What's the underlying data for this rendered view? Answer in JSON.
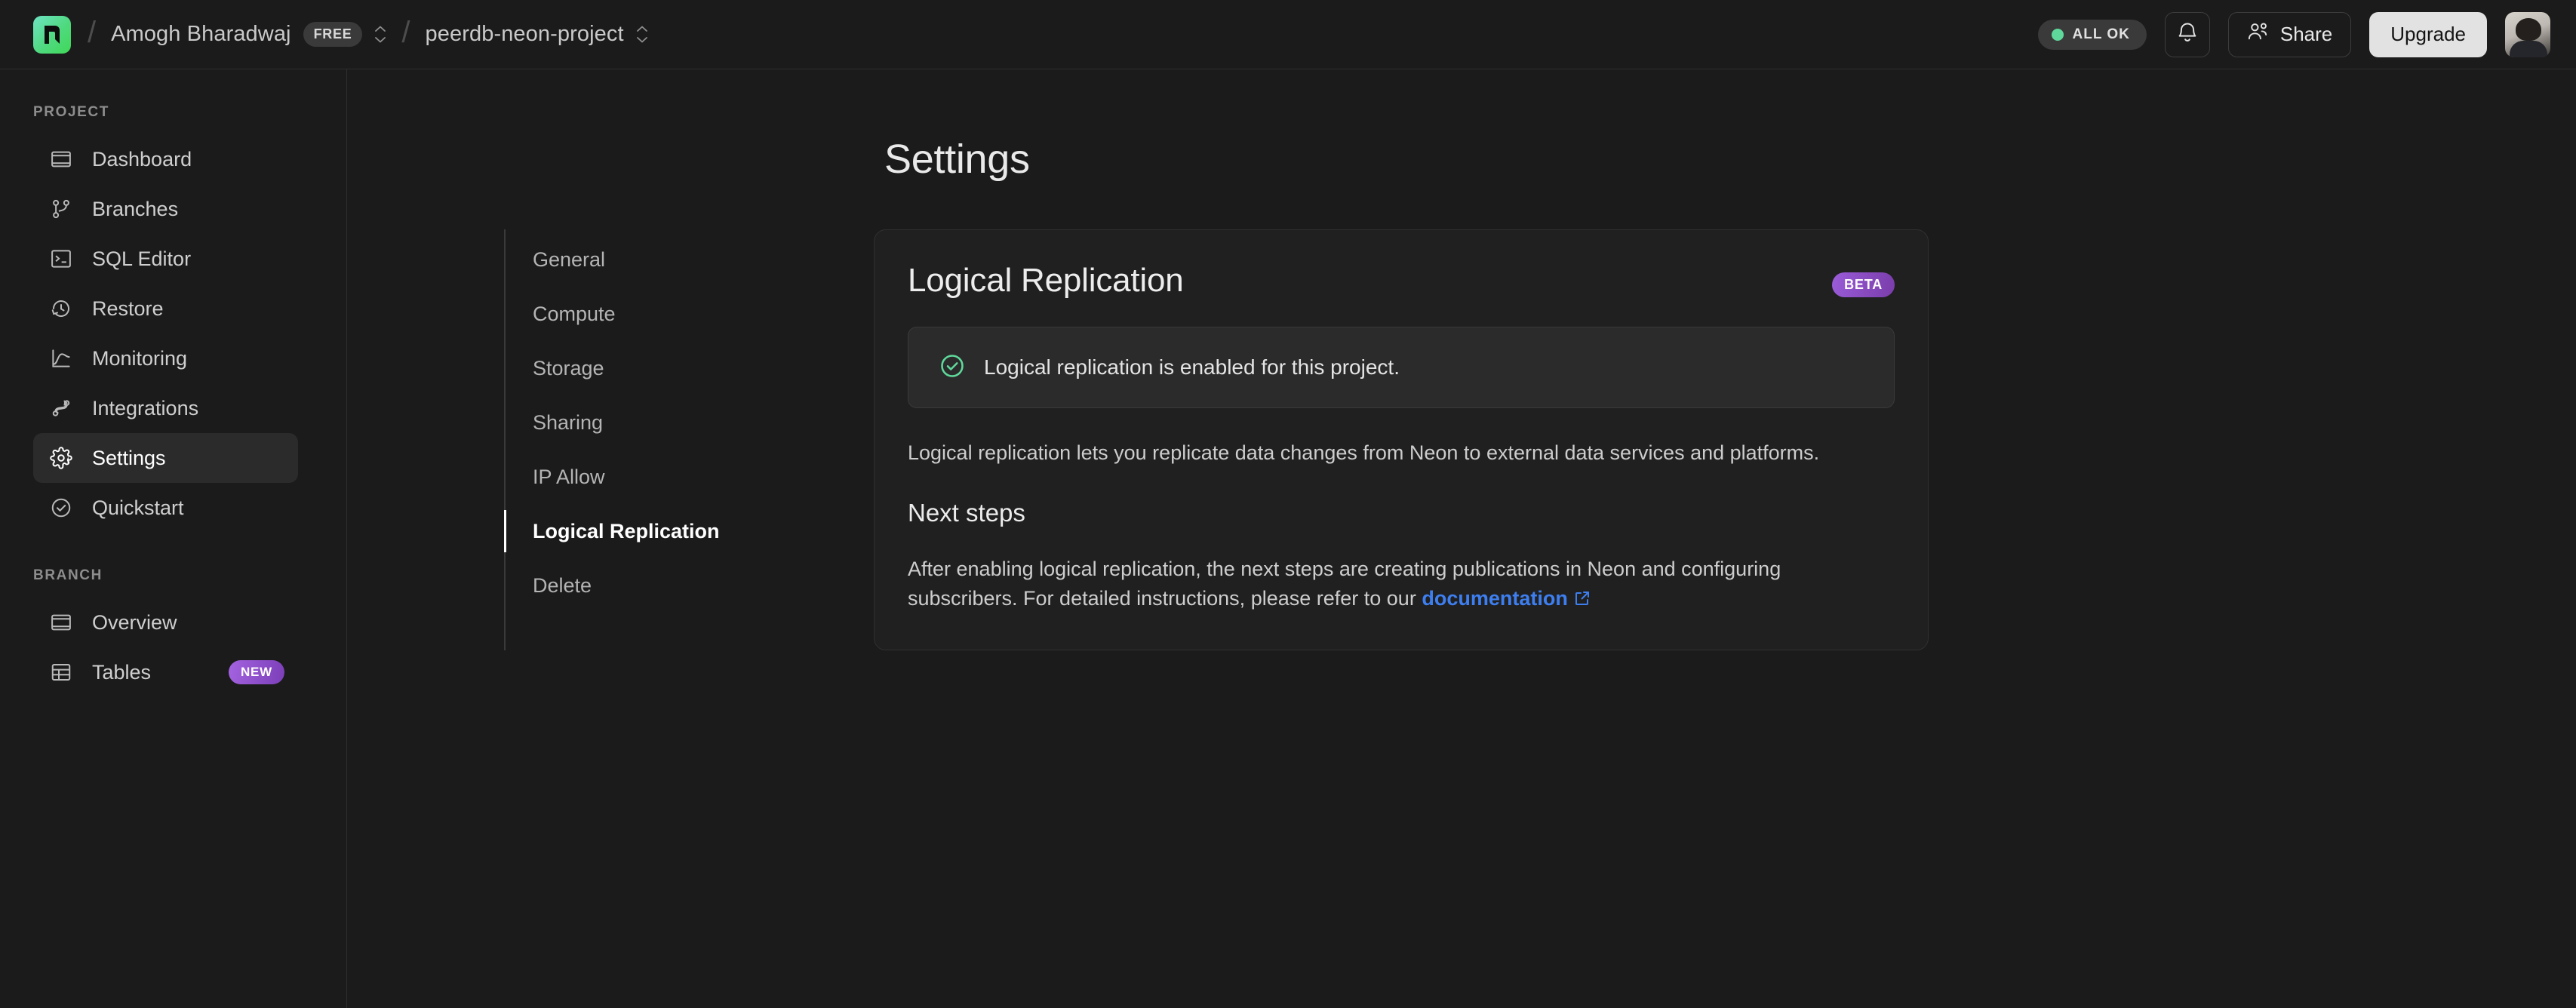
{
  "topbar": {
    "logo_icon": "neon-logo-icon",
    "separator": "/",
    "account": {
      "name": "Amogh Bharadwaj",
      "plan_badge": "FREE",
      "selector_icon": "chevron-updown-icon"
    },
    "project": {
      "name": "peerdb-neon-project",
      "selector_icon": "chevron-updown-icon"
    },
    "status": {
      "label": "ALL OK",
      "dot_color": "#5fd99b"
    },
    "notifications_icon": "bell-icon",
    "share": {
      "label": "Share",
      "icon": "users-icon"
    },
    "upgrade": {
      "label": "Upgrade"
    },
    "avatar": "user-avatar"
  },
  "sidebar": {
    "project_group_label": "PROJECT",
    "project_items": [
      {
        "label": "Dashboard",
        "icon": "dashboard-icon",
        "active": false
      },
      {
        "label": "Branches",
        "icon": "branches-icon",
        "active": false
      },
      {
        "label": "SQL Editor",
        "icon": "sql-editor-icon",
        "active": false
      },
      {
        "label": "Restore",
        "icon": "restore-clock-icon",
        "active": false
      },
      {
        "label": "Monitoring",
        "icon": "monitoring-chart-icon",
        "active": false
      },
      {
        "label": "Integrations",
        "icon": "integrations-icon",
        "active": false
      },
      {
        "label": "Settings",
        "icon": "gear-icon",
        "active": true
      },
      {
        "label": "Quickstart",
        "icon": "check-circle-icon",
        "active": false
      }
    ],
    "branch_group_label": "BRANCH",
    "branch_items": [
      {
        "label": "Overview",
        "icon": "overview-icon",
        "badge": ""
      },
      {
        "label": "Tables",
        "icon": "table-icon",
        "badge": "NEW"
      }
    ]
  },
  "main": {
    "page_title": "Settings",
    "settings_nav": [
      {
        "label": "General",
        "active": false
      },
      {
        "label": "Compute",
        "active": false
      },
      {
        "label": "Storage",
        "active": false
      },
      {
        "label": "Sharing",
        "active": false
      },
      {
        "label": "IP Allow",
        "active": false
      },
      {
        "label": "Logical Replication",
        "active": true
      },
      {
        "label": "Delete",
        "active": false
      }
    ],
    "card": {
      "title": "Logical Replication",
      "badge": "BETA",
      "banner": {
        "icon": "check-circle-icon",
        "text": "Logical replication is enabled for this project."
      },
      "description": "Logical replication lets you replicate data changes from Neon to external data services and platforms.",
      "subheading": "Next steps",
      "next_steps_text_before": "After enabling logical replication, the next steps are creating publications in Neon and configuring subscribers. For detailed instructions, please refer to our ",
      "doc_link_label": "documentation",
      "doc_link_icon": "external-link-icon"
    }
  },
  "colors": {
    "page_bg": "#1b1b1b",
    "card_bg": "#202020",
    "banner_bg": "#2b2b2b",
    "accent_link": "#3d7ff0",
    "success_green": "#5fd99b",
    "beta_purple": "#8a4dc4",
    "new_purple": "#8f4fd0",
    "upgrade_bg": "#e2e2e2"
  }
}
